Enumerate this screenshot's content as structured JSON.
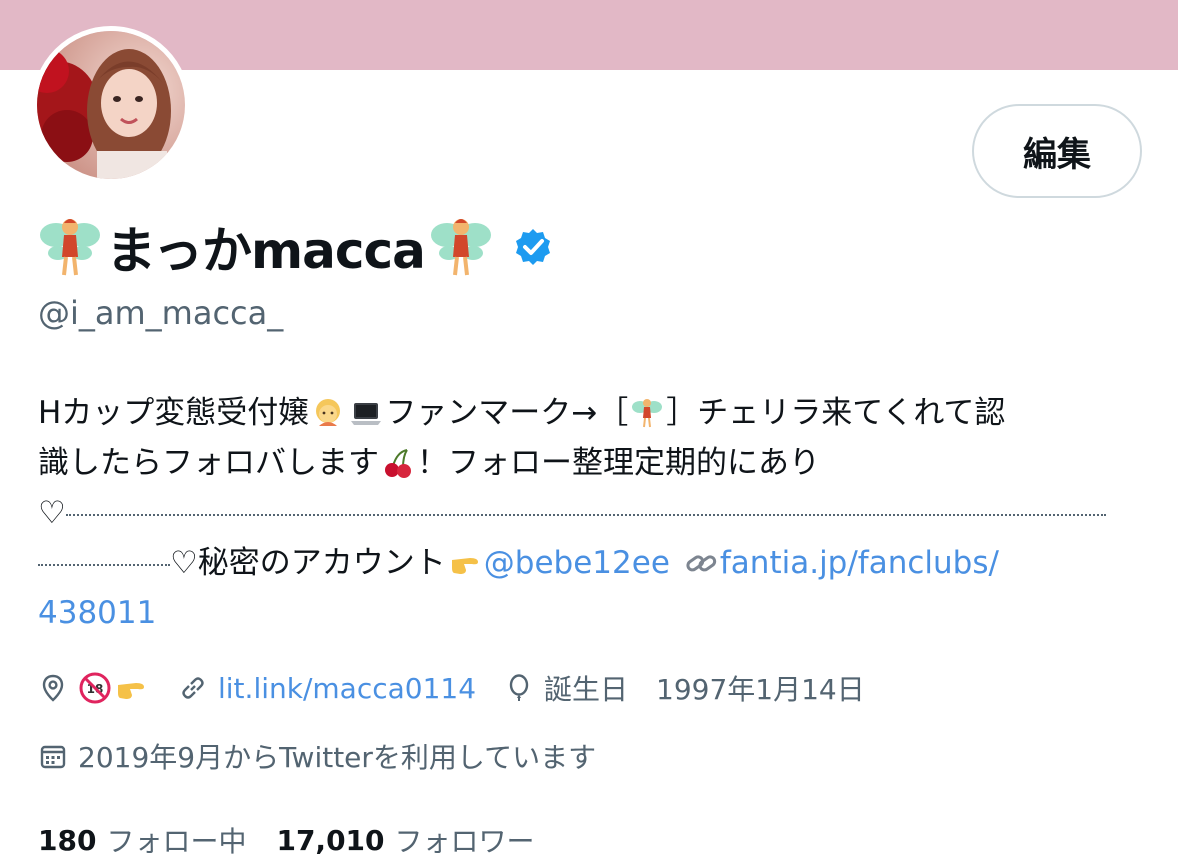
{
  "banner": {
    "color": "#e2b8c6"
  },
  "edit_button": {
    "label": "編集"
  },
  "profile": {
    "name": "まっかmacca",
    "handle": "@i_am_macca_",
    "verified": true
  },
  "bio": {
    "line1_a": "Hカップ変態受付嬢",
    "line1_b": "ファンマーク→［",
    "line1_c": "］チェリラ来てくれて認",
    "line2_a": "識したらフォロバします",
    "line2_b": "！フォロー整理定期的にあり",
    "line3_heart": "♡",
    "line4_heart": "♡",
    "line4_text": "秘密のアカウント",
    "mention": "@bebe12ee",
    "url_a": "fantia.jp/fanclubs/",
    "url_b": "438011"
  },
  "meta": {
    "location_icon": "location-pin-icon",
    "website": "lit.link/macca0114",
    "birthday_label": "誕生日",
    "birthday": "1997年1月14日"
  },
  "joined": {
    "text": "2019年9月からTwitterを利用しています"
  },
  "stats": {
    "following_count": "180",
    "following_label": "フォロー中",
    "followers_count": "17,010",
    "followers_label": "フォロワー"
  },
  "colors": {
    "link": "#4a90e2",
    "secondary": "#536471",
    "verified": "#1d9bf0"
  }
}
